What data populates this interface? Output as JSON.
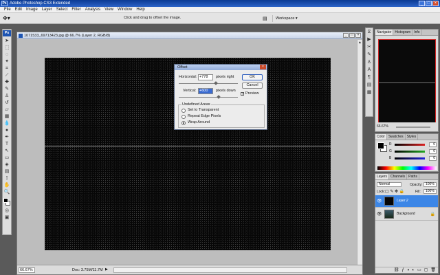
{
  "app": {
    "title": "Adobe Photoshop CS3 Extended",
    "logo": "Ps"
  },
  "window_controls": {
    "minimize": "_",
    "maximize": "□",
    "close": "×"
  },
  "menu": [
    "File",
    "Edit",
    "Image",
    "Layer",
    "Select",
    "Filter",
    "Analysis",
    "View",
    "Window",
    "Help"
  ],
  "options_bar": {
    "hint": "Click and drag to offset the image.",
    "workspace": "Workspace ▾"
  },
  "document": {
    "title": "1071533_69713423.jpg @ 66.7% (Layer 2, RGB/8)",
    "zoom": "66.67%",
    "doc_info": "Doc: 3.75M/11.7M"
  },
  "offset_dialog": {
    "title": "Offset",
    "horizontal_label": "Horizontal:",
    "horizontal_value": "+778",
    "horizontal_unit": "pixels right",
    "vertical_label": "Vertical:",
    "vertical_value": "+600",
    "vertical_unit": "pixels down",
    "ok": "OK",
    "cancel": "Cancel",
    "preview_label": "Preview",
    "preview_checked": true,
    "undefined_areas_label": "Undefined Areas",
    "options": [
      "Set to Transparent",
      "Repeat Edge Pixels",
      "Wrap Around"
    ],
    "selected_option": "Wrap Around"
  },
  "navigator_panel": {
    "tabs": [
      "Navigator",
      "Histogram",
      "Info"
    ],
    "zoom": "66.67%"
  },
  "color_panel": {
    "tabs": [
      "Color",
      "Swatches",
      "Styles"
    ],
    "channels": [
      {
        "label": "R",
        "value": "0",
        "color": "#d22"
      },
      {
        "label": "G",
        "value": "0",
        "color": "#2a2"
      },
      {
        "label": "B",
        "value": "0",
        "color": "#22d"
      }
    ]
  },
  "layers_panel": {
    "tabs": [
      "Layers",
      "Channels",
      "Paths"
    ],
    "blend_mode": "Normal",
    "opacity_label": "Opacity:",
    "opacity": "100%",
    "lock_label": "Lock:",
    "fill_label": "Fill:",
    "fill": "100%",
    "layers": [
      {
        "name": "Layer 2",
        "selected": true
      },
      {
        "name": "Background",
        "selected": false,
        "locked": true
      }
    ]
  }
}
